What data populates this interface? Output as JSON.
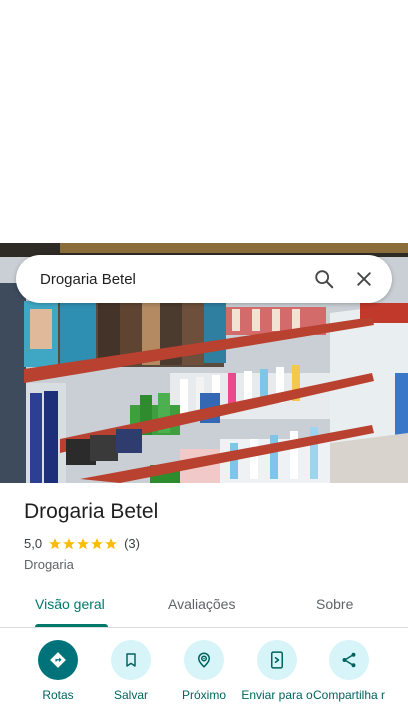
{
  "search": {
    "query": "Drogaria Betel",
    "search_icon": "search-icon",
    "close_icon": "close-icon"
  },
  "hero": {
    "description_icon": "store-photo"
  },
  "place": {
    "name": "Drogaria Betel",
    "rating": "5,0",
    "stars": 5,
    "review_count": "(3)",
    "category": "Drogaria"
  },
  "tabs": [
    {
      "label": "Visão geral",
      "active": true
    },
    {
      "label": "Avaliações",
      "active": false
    },
    {
      "label": "Sobre",
      "active": false
    }
  ],
  "actions": [
    {
      "label": "Rotas",
      "icon": "directions-icon"
    },
    {
      "label": "Salvar",
      "icon": "bookmark-icon"
    },
    {
      "label": "Próximo",
      "icon": "nearby-icon"
    },
    {
      "label": "Enviar para o",
      "icon": "send-to-phone-icon"
    },
    {
      "label": "Compartilha r",
      "icon": "share-icon"
    }
  ],
  "colors": {
    "accent": "#00796b",
    "primary_button": "#00737a",
    "secondary_button": "#d7f4f8",
    "star": "#fbbc04"
  }
}
